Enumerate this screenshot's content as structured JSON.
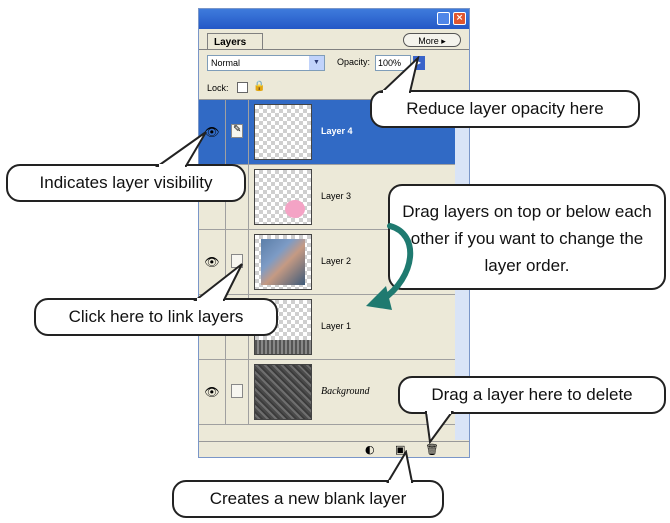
{
  "palette": {
    "tab_label": "Layers",
    "more_button": "More",
    "blend_mode": "Normal",
    "opacity_label": "Opacity:",
    "opacity_value": "100%",
    "lock_label": "Lock:",
    "layers": [
      {
        "name": "Layer 4",
        "selected": true,
        "visible": true,
        "brush": true
      },
      {
        "name": "Layer 3",
        "selected": false,
        "visible": false
      },
      {
        "name": "Layer 2",
        "selected": false,
        "visible": true
      },
      {
        "name": "Layer 1",
        "selected": false,
        "visible": false
      },
      {
        "name": "Background",
        "selected": false,
        "visible": true
      }
    ]
  },
  "callouts": {
    "opacity": "Reduce layer opacity here",
    "visibility": "Indicates layer visibility",
    "drag_reorder": "Drag layers on top or below each other if you want to change the layer order.",
    "link": "Click here to link layers",
    "delete": "Drag a layer here to delete",
    "new_layer": "Creates a new blank layer"
  },
  "colors": {
    "selection": "#316ac5",
    "arrow": "#1f7a70"
  }
}
